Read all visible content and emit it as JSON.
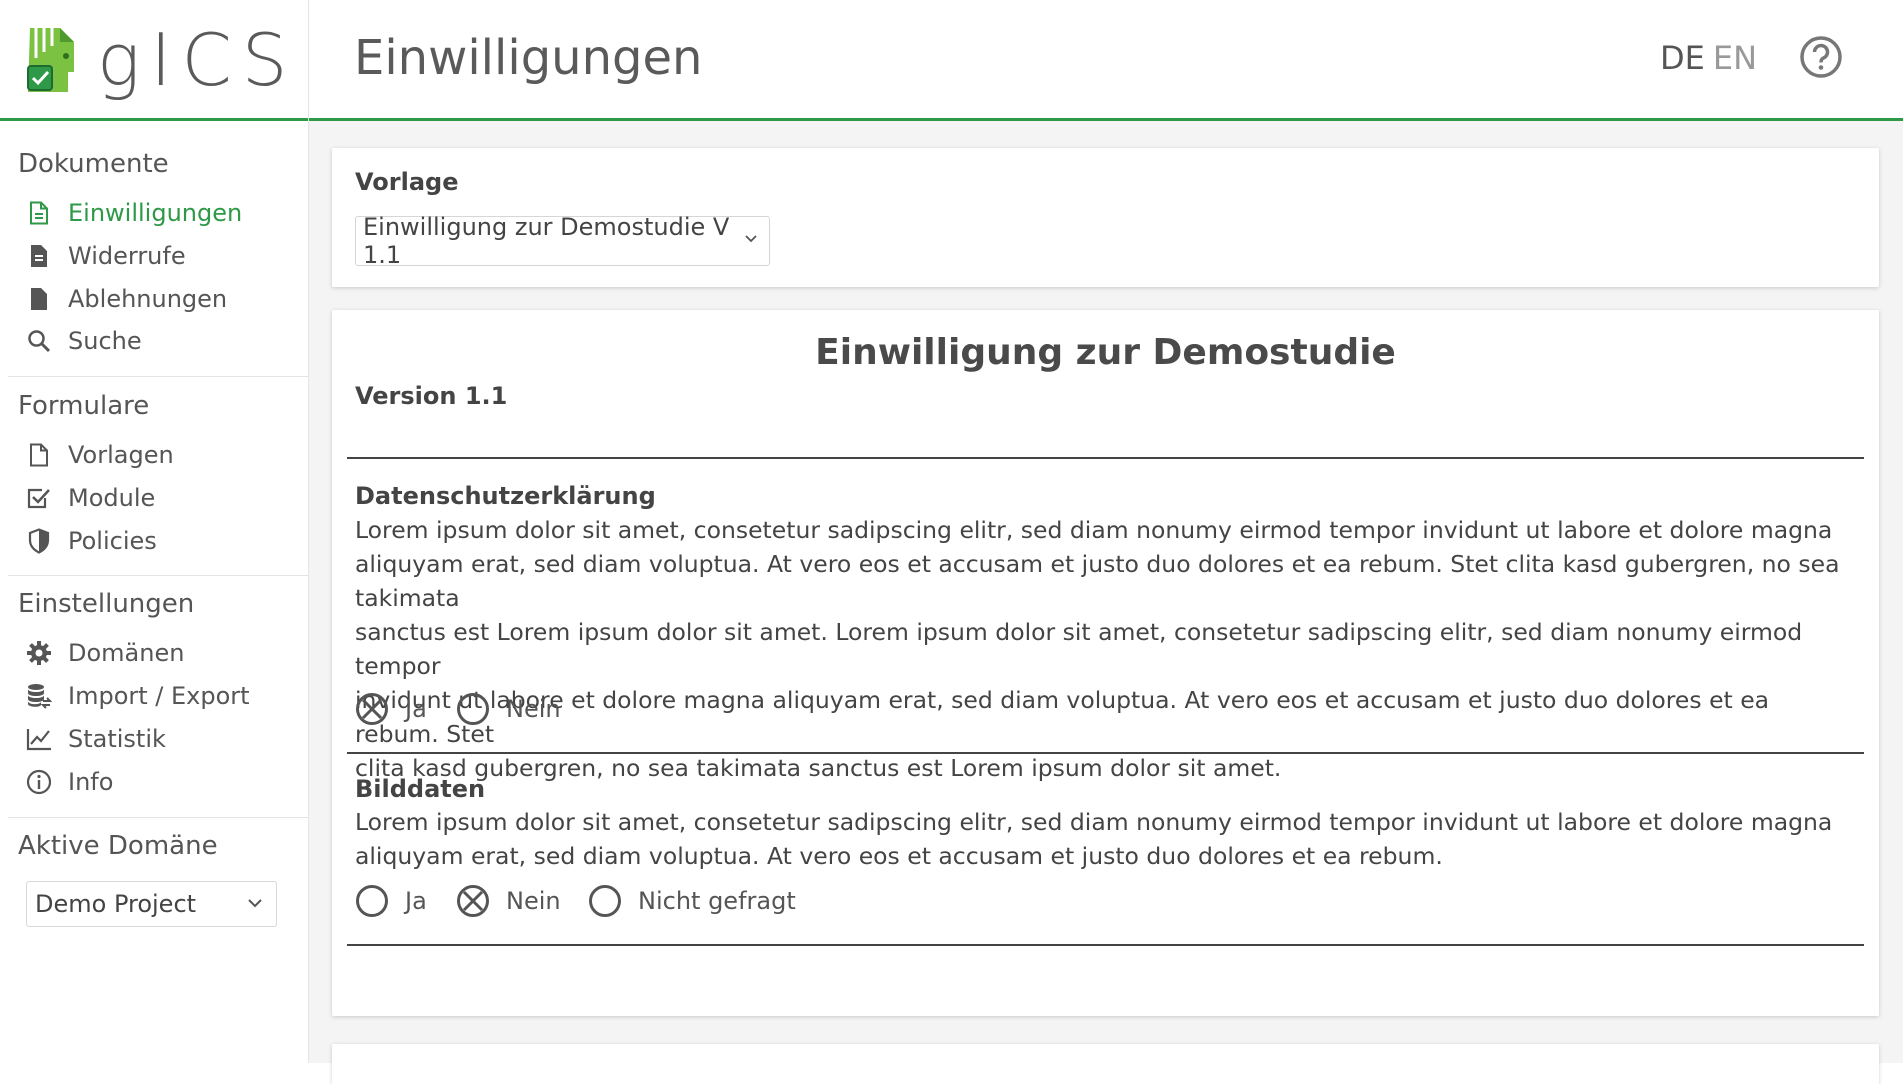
{
  "app": {
    "name": "gICS"
  },
  "header": {
    "title": "Einwilligungen",
    "lang_de": "DE",
    "lang_en": "EN",
    "help_icon": "question-circle-icon"
  },
  "sidebar": {
    "sections": [
      {
        "heading": "Dokumente",
        "items": [
          {
            "label": "Einwilligungen",
            "icon": "file-text-icon",
            "active": true
          },
          {
            "label": "Widerrufe",
            "icon": "file-lines-icon"
          },
          {
            "label": "Ablehnungen",
            "icon": "file-icon"
          },
          {
            "label": "Suche",
            "icon": "search-icon"
          }
        ]
      },
      {
        "heading": "Formulare",
        "items": [
          {
            "label": "Vorlagen",
            "icon": "file-outline-icon"
          },
          {
            "label": "Module",
            "icon": "check-square-icon"
          },
          {
            "label": "Policies",
            "icon": "shield-icon"
          }
        ]
      },
      {
        "heading": "Einstellungen",
        "items": [
          {
            "label": "Domänen",
            "icon": "gear-icon"
          },
          {
            "label": "Import / Export",
            "icon": "database-icon"
          },
          {
            "label": "Statistik",
            "icon": "chart-line-icon"
          },
          {
            "label": "Info",
            "icon": "info-circle-icon"
          }
        ]
      }
    ],
    "active_domain": {
      "heading": "Aktive Domäne",
      "value": "Demo Project"
    }
  },
  "template_card": {
    "label": "Vorlage",
    "selected": "Einwilligung zur Demostudie V 1.1"
  },
  "document": {
    "title": "Einwilligung zur Demostudie",
    "version": "Version 1.1",
    "sections": [
      {
        "title": "Datenschutzerklärung",
        "lines": [
          "Lorem ipsum dolor sit amet, consetetur sadipscing elitr, sed diam nonumy eirmod tempor invidunt ut labore et dolore magna",
          "aliquyam erat, sed diam voluptua. At vero eos et accusam et justo duo dolores et ea rebum. Stet clita kasd gubergren, no sea takimata",
          "sanctus est Lorem ipsum dolor sit amet. Lorem ipsum dolor sit amet, consetetur sadipscing elitr, sed diam nonumy eirmod tempor",
          "invidunt ut labore et dolore magna aliquyam erat, sed diam voluptua. At vero eos et accusam et justo duo dolores et ea rebum. Stet",
          "clita kasd gubergren, no sea takimata sanctus est Lorem ipsum dolor sit amet."
        ],
        "options": [
          {
            "label": "Ja",
            "checked": true
          },
          {
            "label": "Nein",
            "checked": false
          }
        ]
      },
      {
        "title": "Bilddaten",
        "lines": [
          "Lorem ipsum dolor sit amet, consetetur sadipscing elitr, sed diam nonumy eirmod tempor invidunt ut labore et dolore magna",
          "aliquyam erat, sed diam voluptua. At vero eos et accusam et justo duo dolores et ea rebum."
        ],
        "options": [
          {
            "label": "Ja",
            "checked": false
          },
          {
            "label": "Nein",
            "checked": true
          },
          {
            "label": "Nicht gefragt",
            "checked": false
          }
        ]
      }
    ]
  },
  "colors": {
    "accent": "#2e9947",
    "text": "#444444"
  }
}
